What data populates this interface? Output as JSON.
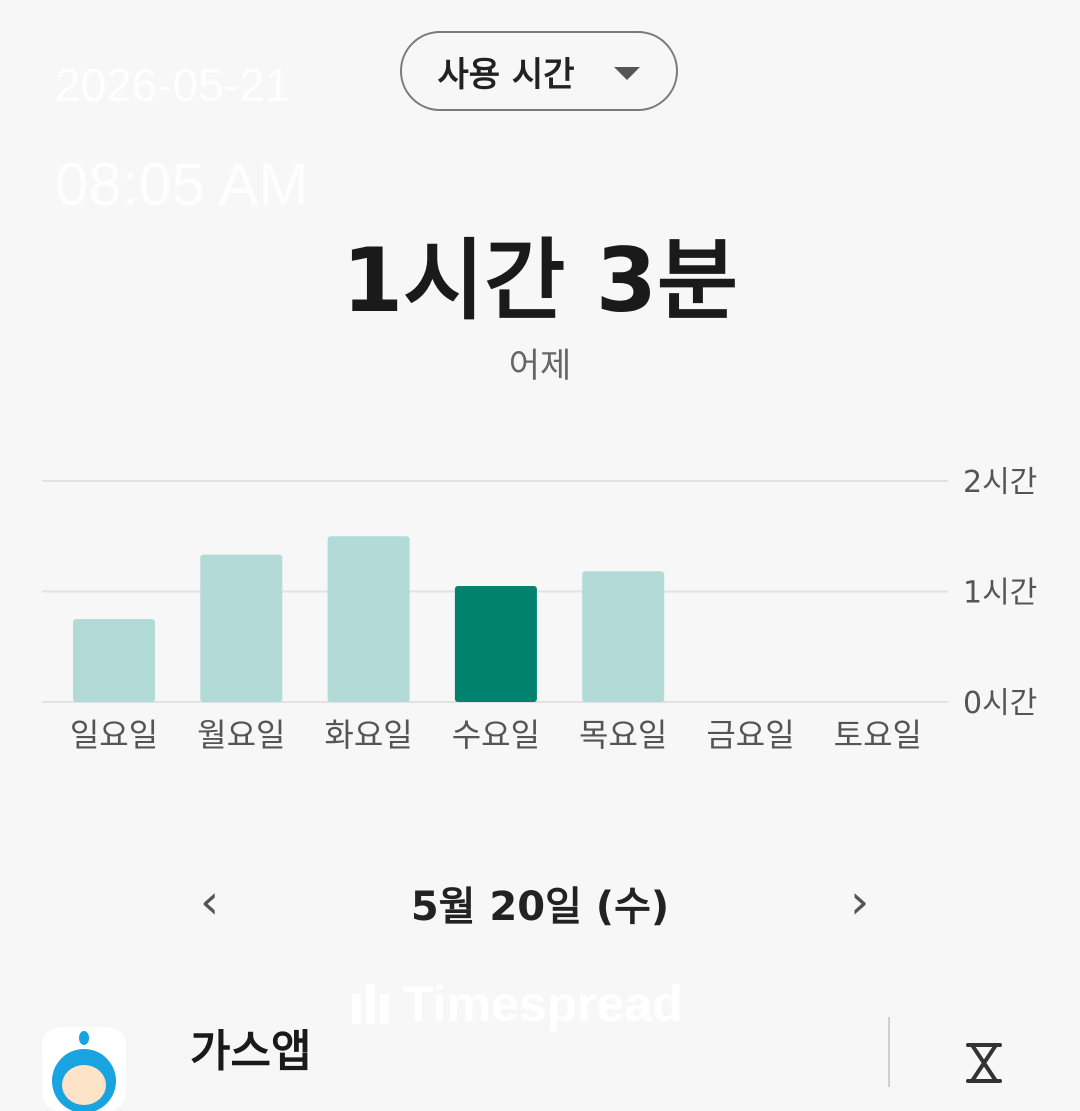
{
  "overlay": {
    "date": "2026-05-21",
    "time": "08:05 AM"
  },
  "header": {
    "dropdown_label": "사용 시간",
    "total_time": "1시간 3분",
    "subtitle": "어제"
  },
  "chart_data": {
    "type": "bar",
    "categories": [
      "일요일",
      "월요일",
      "화요일",
      "수요일",
      "목요일",
      "금요일",
      "토요일"
    ],
    "values_minutes": [
      45,
      80,
      90,
      63,
      71,
      0,
      0
    ],
    "highlight_index": 3,
    "y_ticks": [
      "0시간",
      "1시간",
      "2시간"
    ],
    "y_tick_values_minutes": [
      0,
      60,
      120
    ],
    "ylim_minutes": [
      0,
      120
    ],
    "grid": true,
    "colors": {
      "bar": "#b2dbd7",
      "bar_highlight": "#00826f",
      "grid": "#e2e2e2",
      "label": "#555555"
    }
  },
  "day_nav": {
    "prev_icon": "chevron-left-icon",
    "next_icon": "chevron-right-icon",
    "label": "5월 20일 (수)"
  },
  "watermark": {
    "text": "Timespread"
  },
  "app_list": [
    {
      "name": "가스앱",
      "icon": "gas-app-icon",
      "action_icon": "hourglass-icon"
    }
  ]
}
